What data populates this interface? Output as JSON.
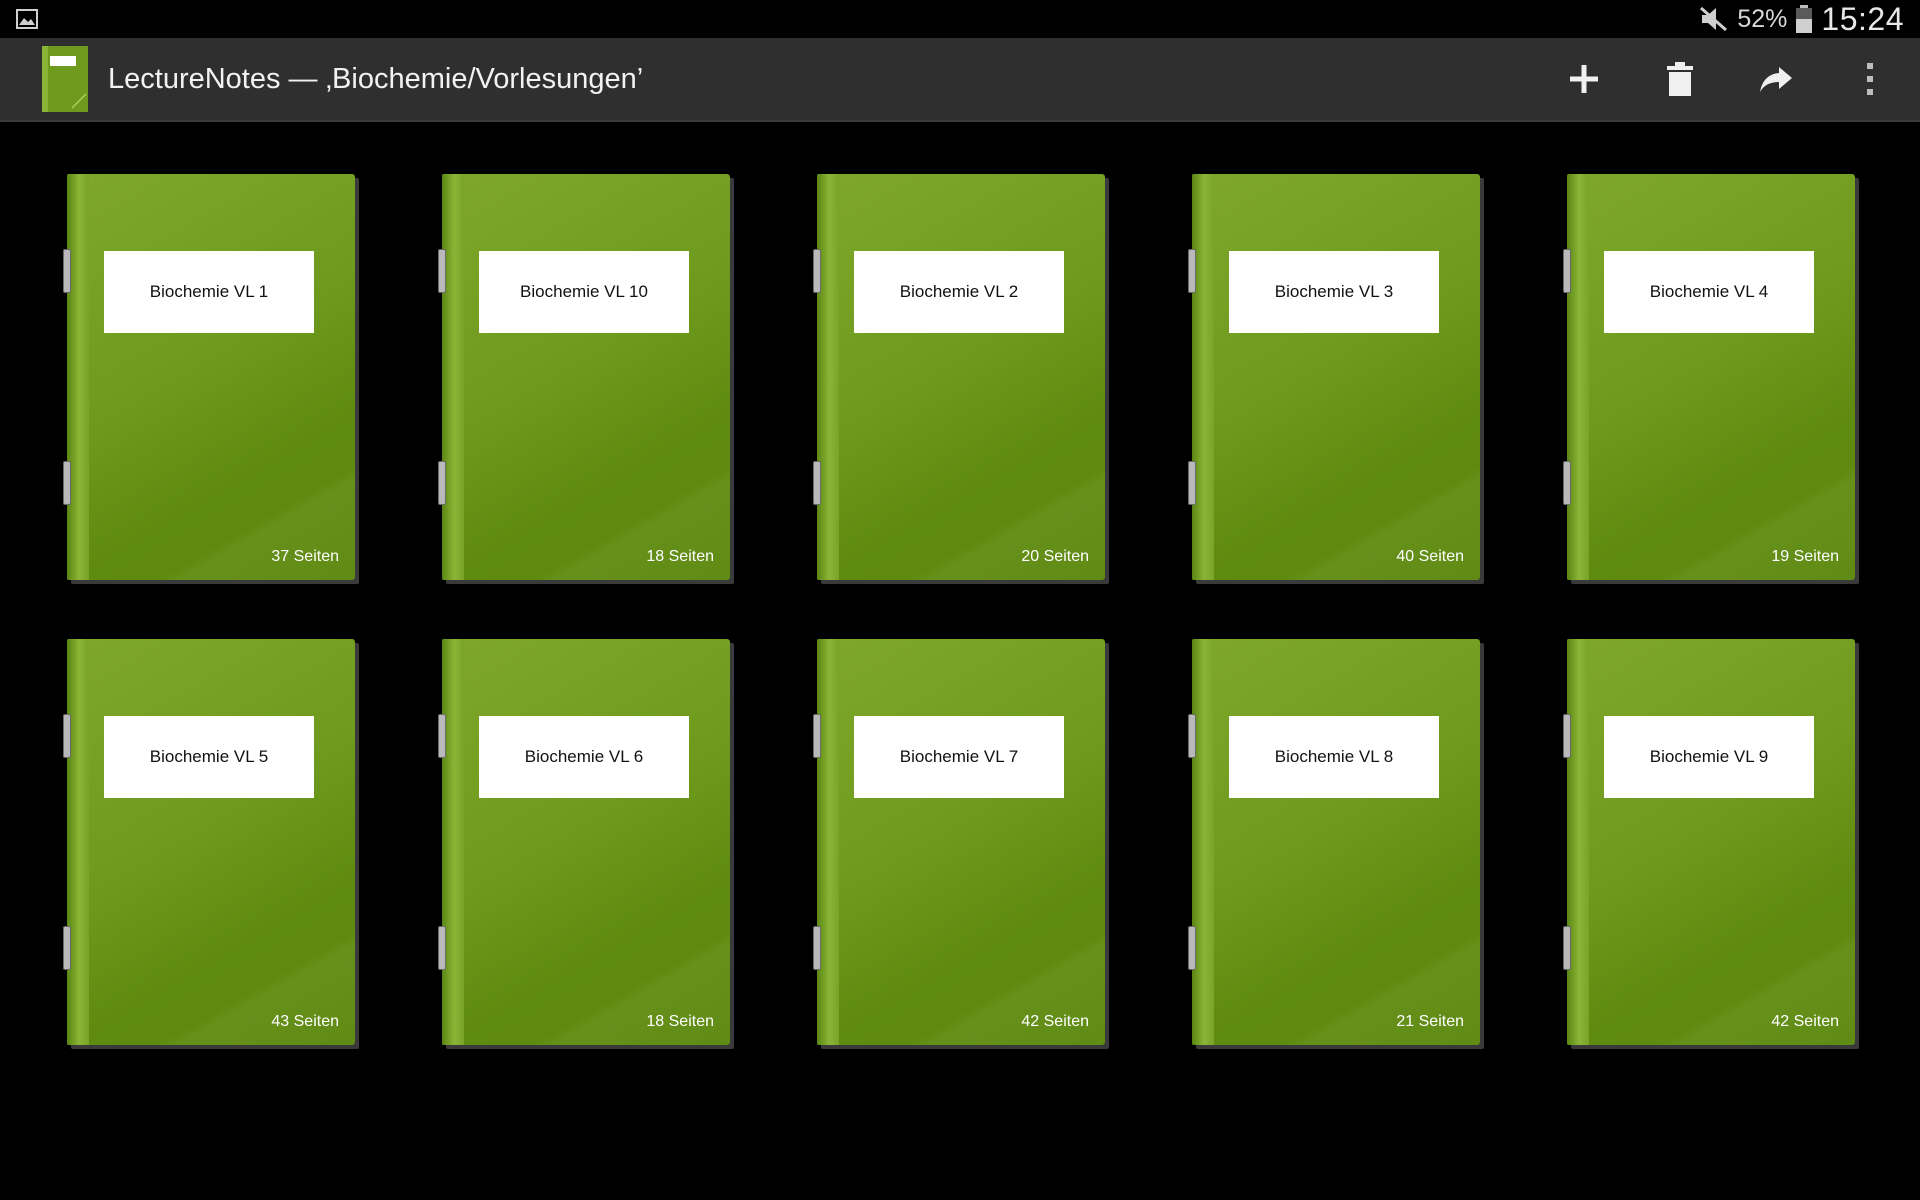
{
  "status_bar": {
    "left_icon": "image-icon",
    "mute_icon": "mute-icon",
    "battery_percent": "52%",
    "battery_icon": "battery-icon",
    "time": "15:24"
  },
  "action_bar": {
    "app_icon": "notebook-icon",
    "title": "LectureNotes — ‚Biochemie/Vorlesungen’",
    "actions": [
      {
        "name": "add",
        "icon": "plus-icon"
      },
      {
        "name": "delete",
        "icon": "trash-icon"
      },
      {
        "name": "share",
        "icon": "share-icon"
      },
      {
        "name": "overflow",
        "icon": "overflow-menu-icon"
      }
    ]
  },
  "colors": {
    "cover_green": "#6e9a1d",
    "action_bar": "#2f2f2f",
    "background": "#000000"
  },
  "notebooks": [
    {
      "title": "Biochemie VL 1",
      "pages": "37 Seiten"
    },
    {
      "title": "Biochemie VL 10",
      "pages": "18 Seiten"
    },
    {
      "title": "Biochemie VL 2",
      "pages": "20 Seiten"
    },
    {
      "title": "Biochemie VL 3",
      "pages": "40 Seiten"
    },
    {
      "title": "Biochemie VL 4",
      "pages": "19 Seiten"
    },
    {
      "title": "Biochemie VL 5",
      "pages": "43 Seiten"
    },
    {
      "title": "Biochemie VL 6",
      "pages": "18 Seiten"
    },
    {
      "title": "Biochemie VL 7",
      "pages": "42 Seiten"
    },
    {
      "title": "Biochemie VL 8",
      "pages": "21 Seiten"
    },
    {
      "title": "Biochemie VL 9",
      "pages": "42 Seiten"
    }
  ]
}
